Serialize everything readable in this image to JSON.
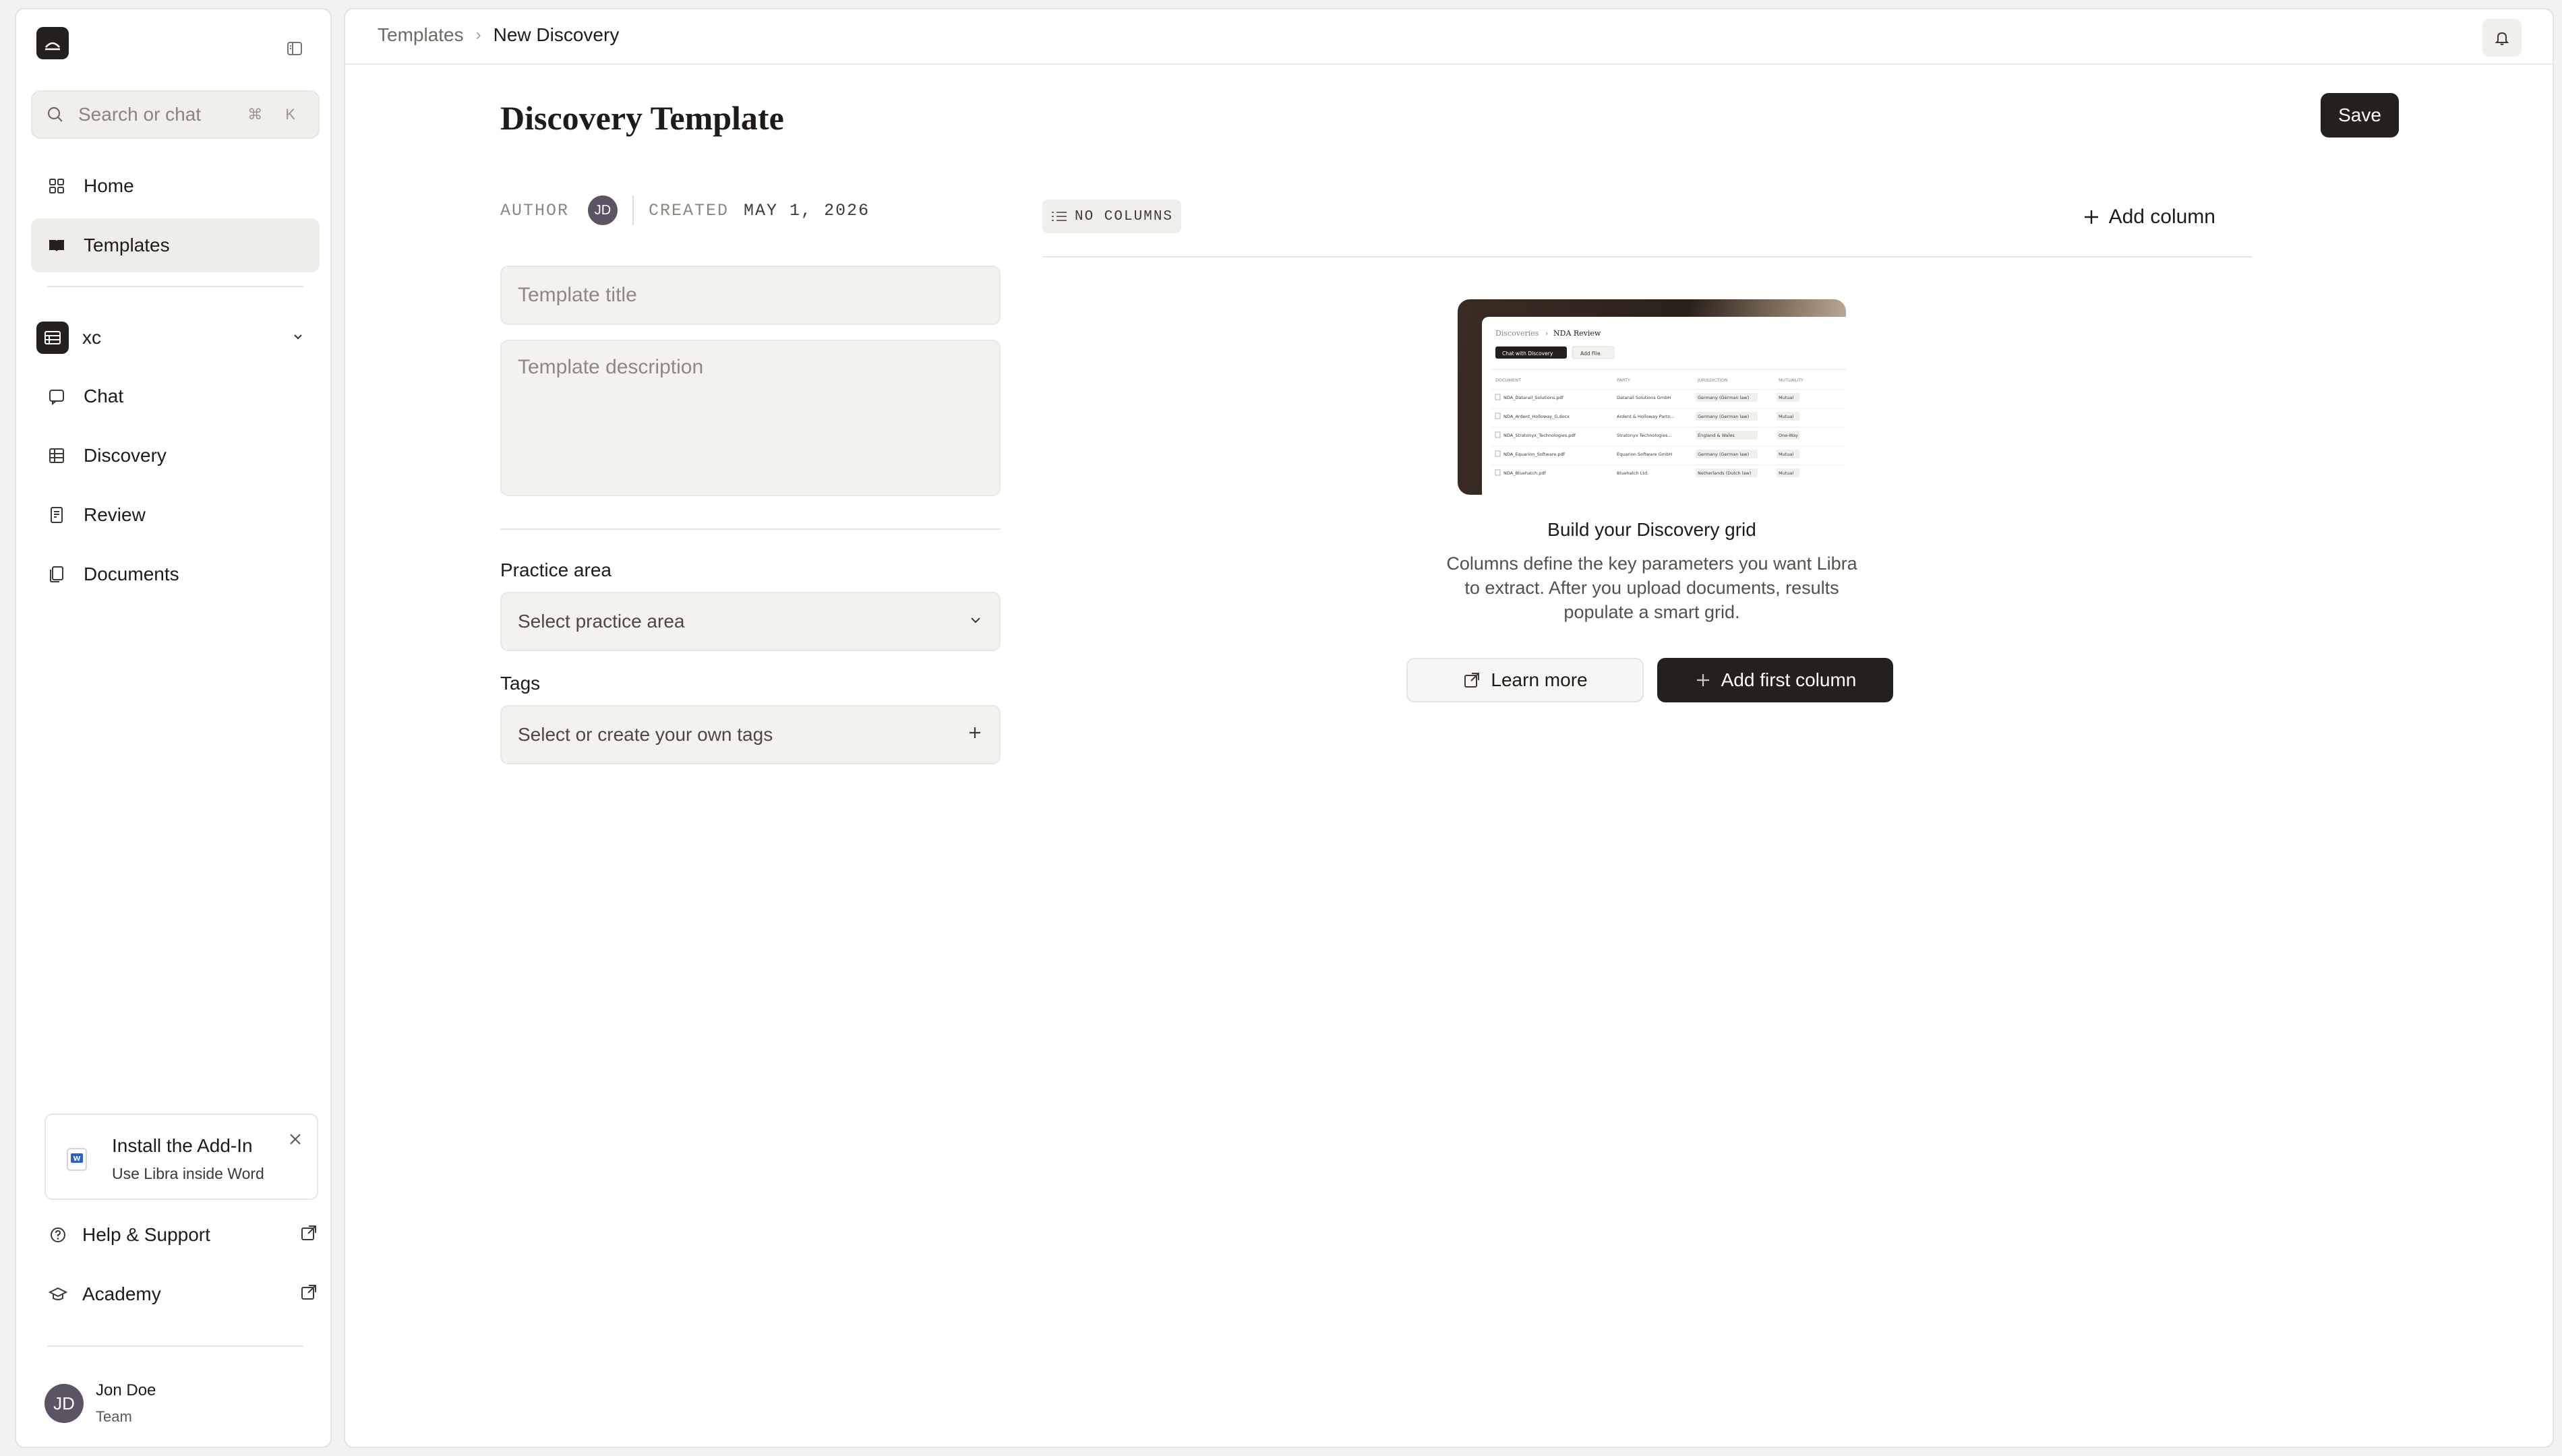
{
  "sidebar": {
    "search": {
      "placeholder": "Search or chat",
      "shortcut": "⌘ K"
    },
    "nav": [
      {
        "label": "Home",
        "icon": "grid-icon"
      },
      {
        "label": "Templates",
        "icon": "book-icon",
        "active": true
      }
    ],
    "workspace": {
      "name": "xc"
    },
    "workspace_nav": [
      {
        "label": "Chat"
      },
      {
        "label": "Discovery"
      },
      {
        "label": "Review"
      },
      {
        "label": "Documents"
      }
    ],
    "addin": {
      "title": "Install the Add-In",
      "subtitle": "Use Libra inside Word"
    },
    "footer_links": [
      {
        "label": "Help & Support"
      },
      {
        "label": "Academy"
      }
    ],
    "user": {
      "initials": "JD",
      "name": "Jon Doe",
      "role": "Team"
    }
  },
  "topbar": {
    "breadcrumb": {
      "parent": "Templates",
      "separator": "›",
      "current": "New Discovery"
    }
  },
  "page": {
    "title": "Discovery Template",
    "save_label": "Save",
    "meta": {
      "author_label": "AUTHOR",
      "author_initials": "JD",
      "created_label": "CREATED",
      "created_value": "MAY 1, 2026"
    },
    "form": {
      "title_placeholder": "Template title",
      "description_placeholder": "Template description",
      "practice_area_label": "Practice area",
      "practice_area_placeholder": "Select practice area",
      "tags_label": "Tags",
      "tags_placeholder": "Select or create your own tags"
    },
    "columns": {
      "badge": "NO COLUMNS",
      "add_label": "Add column"
    },
    "empty_state": {
      "preview": {
        "breadcrumb_parent": "Discoveries",
        "breadcrumb_current": "NDA Review",
        "chat_button": "Chat with Discovery",
        "add_file": "Add File",
        "headers": [
          "DOCUMENT",
          "PARTY",
          "JURISDICTION",
          "MUTUALITY"
        ],
        "rows": [
          [
            "NDA_Datarail_Solutions.pdf",
            "Datarail Solutions GmbH",
            "Germany (German law)",
            "Mutual"
          ],
          [
            "NDA_Ardent_Holloway_G.docx",
            "Ardent & Holloway Partn...",
            "Germany (German law)",
            "Mutual"
          ],
          [
            "NDA_Stratonyx_Technologies.pdf",
            "Stratonyx Technologies...",
            "England & Wales",
            "One-Way"
          ],
          [
            "NDA_Equarion_Software.pdf",
            "Equarion Software GmbH",
            "Germany (German law)",
            "Mutual"
          ],
          [
            "NDA_Bluehatch.pdf",
            "Bluehatch Ltd.",
            "Netherlands (Dutch law)",
            "Mutual"
          ]
        ]
      },
      "title": "Build your Discovery grid",
      "description": "Columns define the key parameters you want Libra to extract. After you upload documents, results populate a smart grid.",
      "learn_more": "Learn more",
      "add_first": "Add first column"
    }
  },
  "colors": {
    "dark": "#24201d",
    "surface": "#f4f2ef",
    "border": "#e7e5e2",
    "avatar": "#5b5463"
  }
}
